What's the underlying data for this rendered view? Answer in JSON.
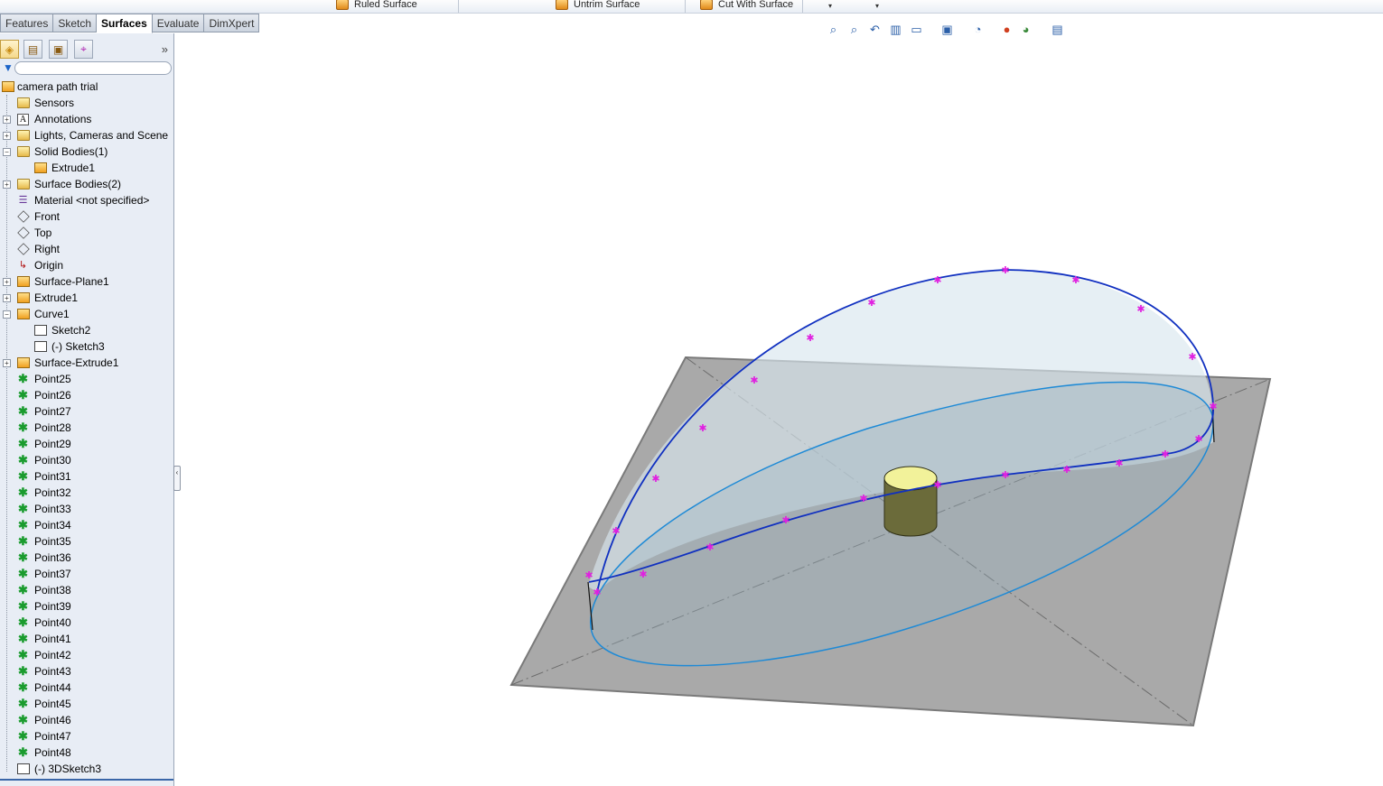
{
  "command_strip": {
    "items": [
      {
        "label": "Ruled Surface",
        "icon": "ruled-surface-icon"
      },
      {
        "label": "Untrim Surface",
        "icon": "untrim-surface-icon"
      },
      {
        "label": "Cut With Surface",
        "icon": "cut-with-surface-icon"
      }
    ],
    "dropdown_glyph": "▾"
  },
  "tabs": [
    {
      "label": "Features",
      "active": false
    },
    {
      "label": "Sketch",
      "active": false
    },
    {
      "label": "Surfaces",
      "active": true
    },
    {
      "label": "Evaluate",
      "active": false
    },
    {
      "label": "DimXpert",
      "active": false
    }
  ],
  "panel": {
    "toolbar_icons": [
      "feature-manager-icon",
      "property-manager-icon",
      "configuration-manager-icon",
      "dimxpert-manager-icon"
    ],
    "expand_glyph": "»",
    "resize_glyph": "‹"
  },
  "tree": {
    "root": "camera path trial",
    "items": [
      {
        "label": "Sensors",
        "icon": "sensors-icon",
        "expander": "",
        "level": 0
      },
      {
        "label": "Annotations",
        "icon": "annotations-icon",
        "expander": "+",
        "level": 0
      },
      {
        "label": "Lights, Cameras and Scene",
        "icon": "lights-icon",
        "expander": "+",
        "level": 0
      },
      {
        "label": "Solid Bodies(1)",
        "icon": "solid-bodies-icon",
        "expander": "−",
        "level": 0
      },
      {
        "label": "Extrude1",
        "icon": "solid-body-icon",
        "expander": "",
        "level": 1
      },
      {
        "label": "Surface Bodies(2)",
        "icon": "surface-bodies-icon",
        "expander": "+",
        "level": 0
      },
      {
        "label": "Material <not specified>",
        "icon": "material-icon",
        "expander": "",
        "level": 0
      },
      {
        "label": "Front",
        "icon": "plane-icon",
        "expander": "",
        "level": 0
      },
      {
        "label": "Top",
        "icon": "plane-icon",
        "expander": "",
        "level": 0
      },
      {
        "label": "Right",
        "icon": "plane-icon",
        "expander": "",
        "level": 0
      },
      {
        "label": "Origin",
        "icon": "origin-icon",
        "expander": "",
        "level": 0
      },
      {
        "label": "Surface-Plane1",
        "icon": "surface-plane-icon",
        "expander": "+",
        "level": 0
      },
      {
        "label": "Extrude1",
        "icon": "extrude-icon",
        "expander": "+",
        "level": 0
      },
      {
        "label": "Curve1",
        "icon": "curve-icon",
        "expander": "−",
        "level": 0
      },
      {
        "label": "Sketch2",
        "icon": "sketch-icon",
        "expander": "",
        "level": 1
      },
      {
        "label": "(-) Sketch3",
        "icon": "sketch-icon",
        "expander": "",
        "level": 1
      },
      {
        "label": "Surface-Extrude1",
        "icon": "surface-extrude-icon",
        "expander": "+",
        "level": 0
      },
      {
        "label": "Point25",
        "icon": "point-icon",
        "expander": "",
        "level": 0
      },
      {
        "label": "Point26",
        "icon": "point-icon",
        "expander": "",
        "level": 0
      },
      {
        "label": "Point27",
        "icon": "point-icon",
        "expander": "",
        "level": 0
      },
      {
        "label": "Point28",
        "icon": "point-icon",
        "expander": "",
        "level": 0
      },
      {
        "label": "Point29",
        "icon": "point-icon",
        "expander": "",
        "level": 0
      },
      {
        "label": "Point30",
        "icon": "point-icon",
        "expander": "",
        "level": 0
      },
      {
        "label": "Point31",
        "icon": "point-icon",
        "expander": "",
        "level": 0
      },
      {
        "label": "Point32",
        "icon": "point-icon",
        "expander": "",
        "level": 0
      },
      {
        "label": "Point33",
        "icon": "point-icon",
        "expander": "",
        "level": 0
      },
      {
        "label": "Point34",
        "icon": "point-icon",
        "expander": "",
        "level": 0
      },
      {
        "label": "Point35",
        "icon": "point-icon",
        "expander": "",
        "level": 0
      },
      {
        "label": "Point36",
        "icon": "point-icon",
        "expander": "",
        "level": 0
      },
      {
        "label": "Point37",
        "icon": "point-icon",
        "expander": "",
        "level": 0
      },
      {
        "label": "Point38",
        "icon": "point-icon",
        "expander": "",
        "level": 0
      },
      {
        "label": "Point39",
        "icon": "point-icon",
        "expander": "",
        "level": 0
      },
      {
        "label": "Point40",
        "icon": "point-icon",
        "expander": "",
        "level": 0
      },
      {
        "label": "Point41",
        "icon": "point-icon",
        "expander": "",
        "level": 0
      },
      {
        "label": "Point42",
        "icon": "point-icon",
        "expander": "",
        "level": 0
      },
      {
        "label": "Point43",
        "icon": "point-icon",
        "expander": "",
        "level": 0
      },
      {
        "label": "Point44",
        "icon": "point-icon",
        "expander": "",
        "level": 0
      },
      {
        "label": "Point45",
        "icon": "point-icon",
        "expander": "",
        "level": 0
      },
      {
        "label": "Point46",
        "icon": "point-icon",
        "expander": "",
        "level": 0
      },
      {
        "label": "Point47",
        "icon": "point-icon",
        "expander": "",
        "level": 0
      },
      {
        "label": "Point48",
        "icon": "point-icon",
        "expander": "",
        "level": 0
      },
      {
        "label": "(-) 3DSketch3",
        "icon": "3dsketch-icon",
        "expander": "",
        "level": 0
      }
    ]
  },
  "hud_icons": [
    "zoom-to-fit-icon",
    "zoom-to-area-icon",
    "previous-view-icon",
    "section-view-icon",
    "view-orientation-icon",
    "display-style-icon",
    "hide-show-items-icon",
    "edit-appearance-icon",
    "apply-scene-icon",
    "view-settings-icon"
  ],
  "colors": {
    "panel_bg": "#e8edf5",
    "curve_blue": "#1030c0",
    "ellipse_blue": "#1e8ad6",
    "point_marker": "#e020e0",
    "plane_gray": "#a9a9a9",
    "cylinder_top": "#f2f29a",
    "cylinder_side": "#6b6b3a"
  }
}
